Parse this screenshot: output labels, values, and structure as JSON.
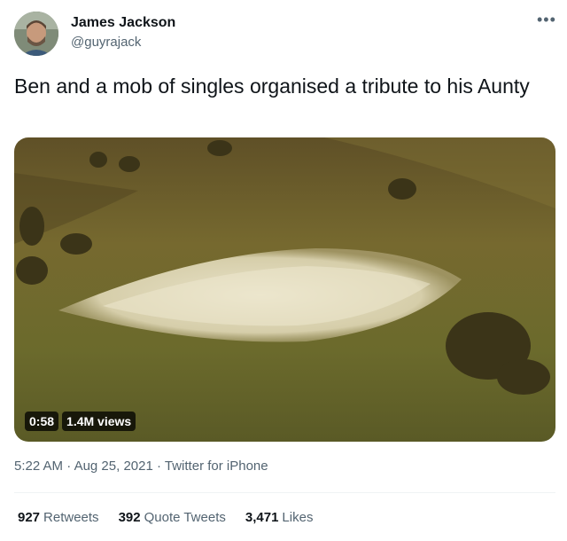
{
  "author": {
    "name": "James Jackson",
    "handle": "@guyrajack"
  },
  "tweet": {
    "text": "Ben and a mob of singles organised a tribute to his Aunty"
  },
  "video": {
    "duration": "0:58",
    "views": "1.4M views"
  },
  "meta": {
    "time": "5:22 AM",
    "date": "Aug 25, 2021",
    "source": "Twitter for iPhone",
    "sep": "·"
  },
  "stats": {
    "retweets_count": "927",
    "retweets_label": "Retweets",
    "quotes_count": "392",
    "quotes_label": "Quote Tweets",
    "likes_count": "3,471",
    "likes_label": "Likes"
  },
  "icons": {
    "more": "more-options-icon"
  }
}
